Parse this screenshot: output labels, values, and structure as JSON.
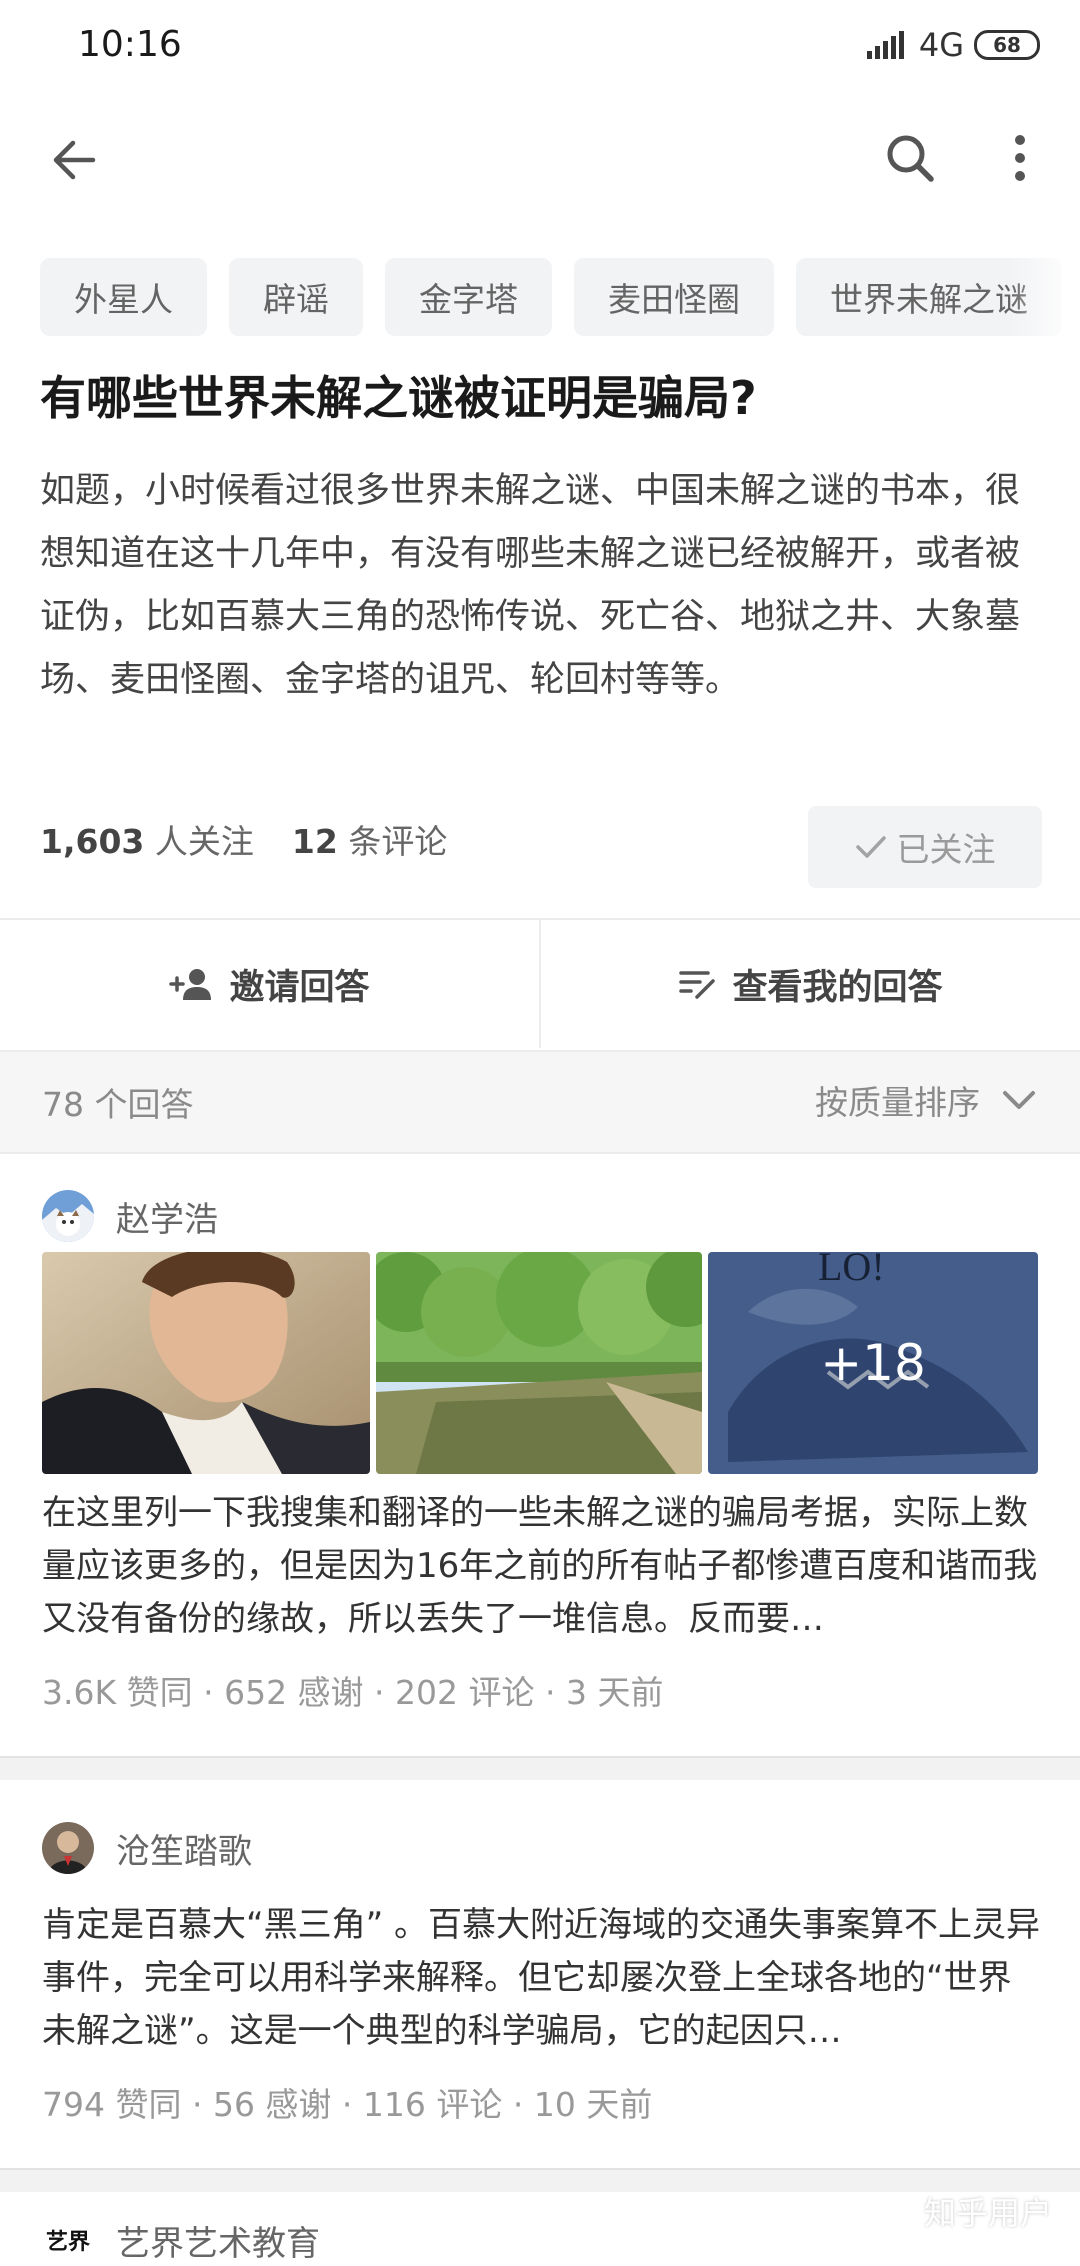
{
  "status_bar": {
    "time": "10:16",
    "network": "4G",
    "battery": "68"
  },
  "app_bar": {
    "back_icon": "arrow-left-icon",
    "search_icon": "search-icon",
    "more_icon": "more-vertical-icon"
  },
  "topics": [
    "外星人",
    "辟谣",
    "金字塔",
    "麦田怪圈",
    "世界未解之谜"
  ],
  "question": {
    "title": "有哪些世界未解之谜被证明是骗局?",
    "detail": "如题，小时候看过很多世界未解之谜、中国未解之谜的书本，很想知道在这十几年中，有没有哪些未解之谜已经被解开，或者被证伪，比如百慕大三角的恐怖传说、死亡谷、地狱之井、大象墓场、麦田怪圈、金字塔的诅咒、轮回村等等。",
    "followers_count": "1,603",
    "followers_label": "人关注",
    "comments_count": "12",
    "comments_label": "条评论",
    "follow_button": "已关注"
  },
  "actions": {
    "invite": "邀请回答",
    "my_answer": "查看我的回答"
  },
  "answers_header": {
    "count": "78 个回答",
    "sort": "按质量排序"
  },
  "answers": [
    {
      "author": "赵学浩",
      "image_more": "+18",
      "excerpt": "在这里列一下我搜集和翻译的一些未解之谜的骗局考据，实际上数量应该更多的，但是因为16年之前的所有帖子都惨遭百度和谐而我又没有备份的缘故，所以丢失了一堆信息。反而要…",
      "meta": "3.6K 赞同 · 652 感谢 · 202 评论 · 3 天前"
    },
    {
      "author": "沧笙踏歌",
      "excerpt": "肯定是百慕大“黑三角” 。百慕大附近海域的交通失事案算不上灵异事件，完全可以用科学来解释。但它却屡次登上全球各地的“世界未解之谜”。这是一个典型的科学骗局，它的起因只…",
      "meta": "794 赞同 · 56 感谢 · 116 评论 · 10 天前"
    },
    {
      "author": "艺界艺术教育",
      "avatar_text": "艺界"
    }
  ],
  "watermark": "知乎用户",
  "colors": {
    "background": "#ffffff",
    "chip_bg": "#f2f3f5",
    "muted_text": "#999999",
    "header_band": "#f6f6f6"
  }
}
